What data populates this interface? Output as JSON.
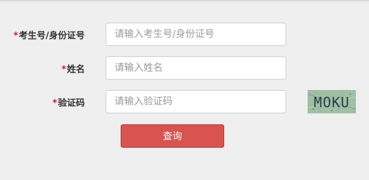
{
  "form": {
    "exam_id": {
      "required_mark": "*",
      "label": "考生号/身份证号",
      "value": "",
      "placeholder": "请输入考生号/身份证号"
    },
    "name": {
      "required_mark": "*",
      "label": "姓名",
      "value": "",
      "placeholder": "请输入姓名"
    },
    "captcha": {
      "required_mark": "*",
      "label": "验证码",
      "value": "",
      "placeholder": "请输入验证码",
      "image_text": "MOKU"
    },
    "submit_label": "查询"
  },
  "colors": {
    "background": "#efefef",
    "required_mark": "#c62828",
    "button": "#d9534f",
    "captcha_bg": "#9fbfa0",
    "captcha_text": "#2a3e4a"
  }
}
